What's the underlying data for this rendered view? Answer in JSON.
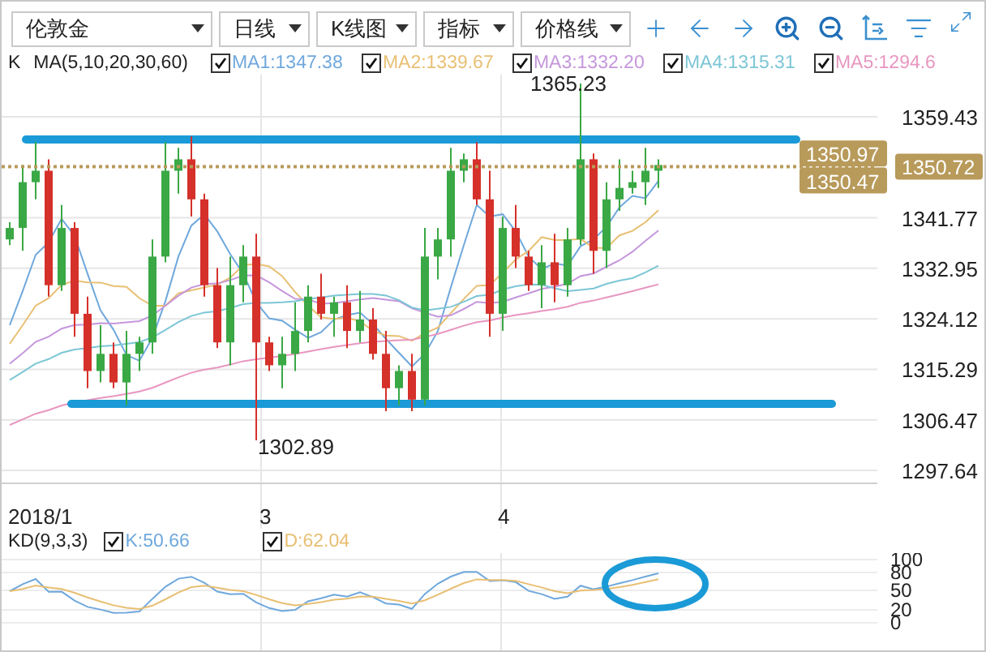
{
  "toolbar": {
    "selects": [
      {
        "label": "伦敦金"
      },
      {
        "label": "日线"
      },
      {
        "label": "K线图"
      },
      {
        "label": "指标"
      },
      {
        "label": "价格线"
      }
    ]
  },
  "legend": {
    "series": "K",
    "indicator": "MA(5,10,20,30,60)",
    "items": [
      {
        "label": "MA1:1347.38",
        "checked": true,
        "color": "#6fa8dc"
      },
      {
        "label": "MA2:1339.67",
        "checked": true,
        "color": "#e8bf73"
      },
      {
        "label": "MA3:1332.20",
        "checked": true,
        "color": "#c596dc"
      },
      {
        "label": "MA4:1315.31",
        "checked": true,
        "color": "#7cc6d6"
      },
      {
        "label": "MA5:1294.6",
        "checked": true,
        "color": "#e896c0"
      }
    ]
  },
  "chart": {
    "high_label": "1365.23",
    "low_label": "1302.89",
    "y_ticks": [
      "1359.43",
      "1341.77",
      "1332.95",
      "1324.12",
      "1315.29",
      "1306.47",
      "1297.64"
    ],
    "price_tags": [
      {
        "label": "1350.97",
        "kind": "upper"
      },
      {
        "label": "1350.72",
        "kind": "current"
      },
      {
        "label": "1350.47",
        "kind": "lower"
      }
    ],
    "x_labels": [
      "2018/1",
      "3",
      "4"
    ]
  },
  "kd": {
    "indicator": "KD(9,3,3)",
    "items": [
      {
        "label": "K:50.66",
        "checked": true,
        "color": "#6fa8dc"
      },
      {
        "label": "D:62.04",
        "checked": true,
        "color": "#e8bf73"
      }
    ],
    "y_ticks": [
      "100",
      "80",
      "50",
      "20",
      "0"
    ]
  }
}
